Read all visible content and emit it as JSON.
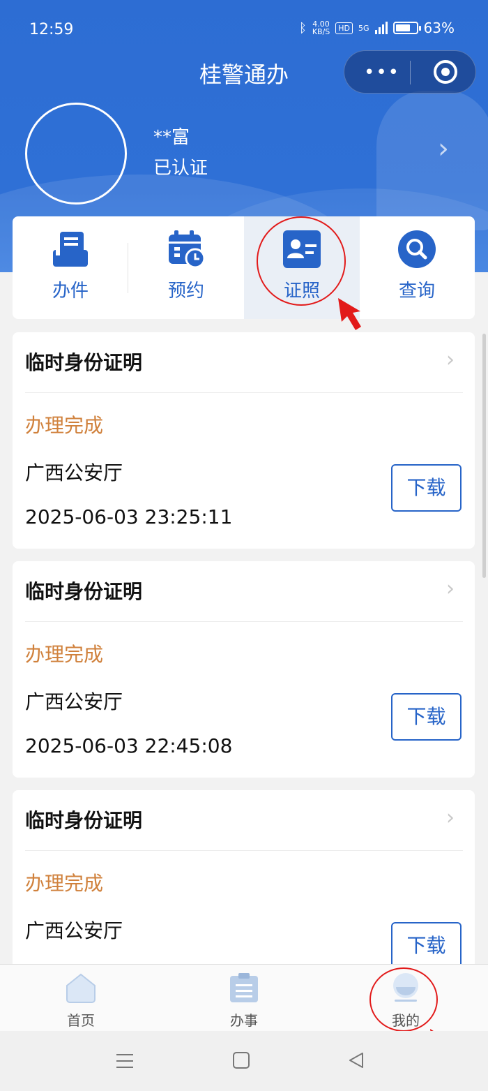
{
  "status_bar": {
    "time": "12:59",
    "net_speed_top": "4.00",
    "net_speed_unit": "KB/S",
    "hd": "HD",
    "network": "5G",
    "battery": "63%"
  },
  "app": {
    "title": "桂警通办"
  },
  "profile": {
    "name": "**富",
    "status": "已认证"
  },
  "tabs": [
    {
      "label": "办件",
      "icon": "file-tray-icon"
    },
    {
      "label": "预约",
      "icon": "calendar-clock-icon"
    },
    {
      "label": "证照",
      "icon": "id-card-icon",
      "active": true
    },
    {
      "label": "查询",
      "icon": "search-icon"
    }
  ],
  "records": [
    {
      "title": "临时身份证明",
      "status": "办理完成",
      "org": "广西公安厅",
      "datetime": "2025-06-03 23:25:11",
      "action": "下载"
    },
    {
      "title": "临时身份证明",
      "status": "办理完成",
      "org": "广西公安厅",
      "datetime": "2025-06-03 22:45:08",
      "action": "下载"
    },
    {
      "title": "临时身份证明",
      "status": "办理完成",
      "org": "广西公安厅",
      "datetime": "",
      "action": "下载"
    }
  ],
  "bottom_nav": [
    {
      "label": "首页",
      "icon": "home-icon"
    },
    {
      "label": "办事",
      "icon": "clipboard-icon"
    },
    {
      "label": "我的",
      "icon": "user-icon"
    }
  ],
  "colors": {
    "brand_blue": "#2764c8",
    "header_blue": "#2f70d6",
    "status_orange": "#d0813c",
    "annotation_red": "#e21a1a"
  }
}
